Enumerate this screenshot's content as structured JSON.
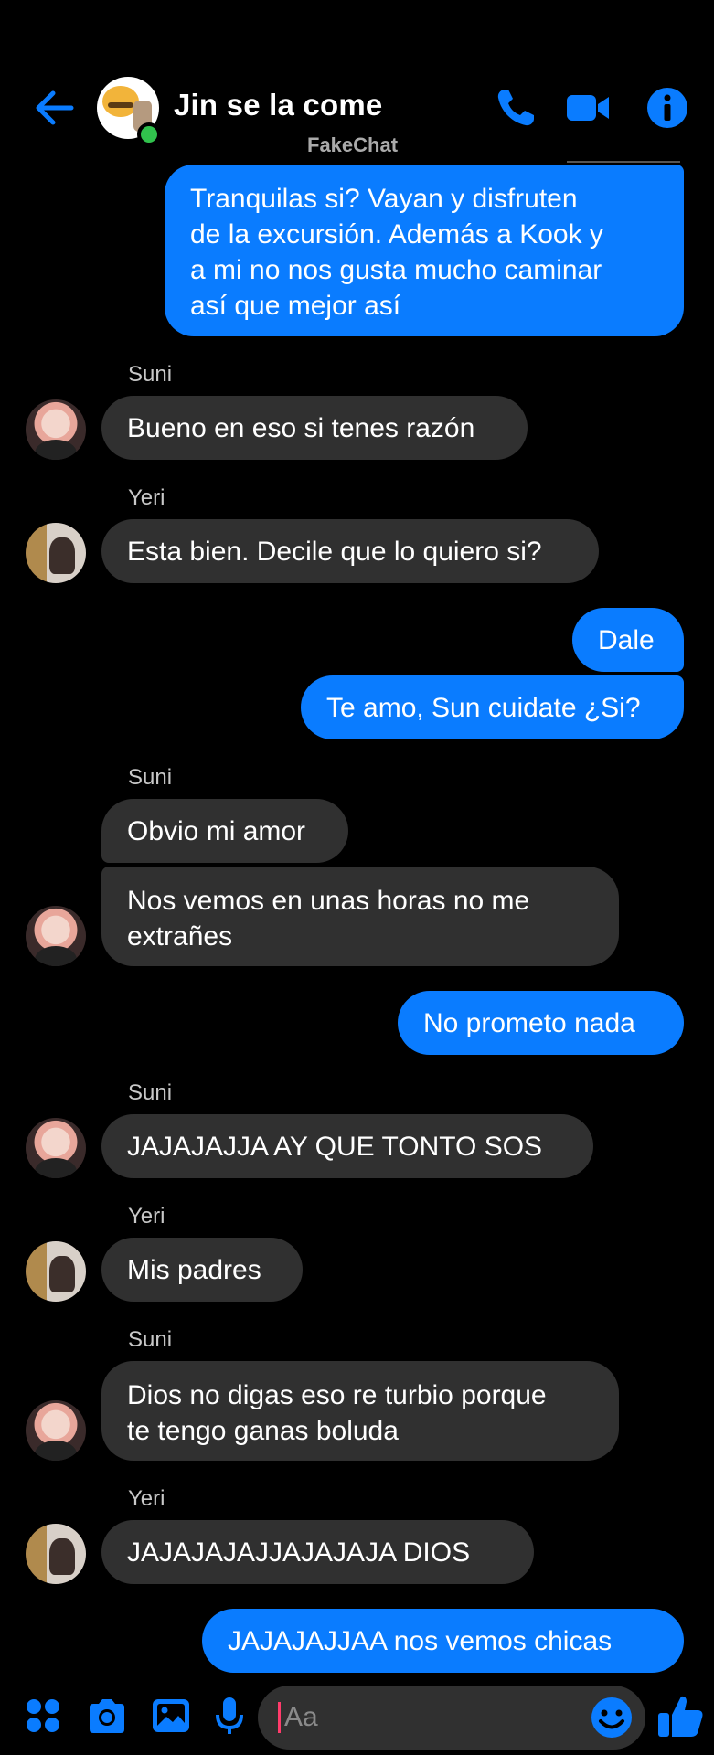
{
  "header": {
    "title": "Jin se la come",
    "watermark": "FakeChat"
  },
  "colors": {
    "accent": "#0a7cff",
    "incoming": "#303030",
    "online": "#31c24d"
  },
  "icons": {
    "back": "arrow-left-icon",
    "call": "phone-icon",
    "video": "video-camera-icon",
    "info": "info-icon",
    "apps": "apps-grid-icon",
    "camera": "camera-icon",
    "gallery": "image-icon",
    "mic": "microphone-icon",
    "emoji": "emoji-icon",
    "like": "thumbs-up-icon"
  },
  "messages": [
    {
      "dir": "out",
      "text": "Tranquilas si? Vayan y disfruten\nde la excursión. Además a Kook y\na mi no nos gusta mucho caminar\nasí que mejor así"
    },
    {
      "sender": "Suni",
      "dir": "in",
      "text": "Bueno en eso si tenes razón"
    },
    {
      "sender": "Yeri",
      "dir": "in",
      "text": "Esta bien. Decile que lo quiero si?"
    },
    {
      "dir": "out",
      "text": "Dale"
    },
    {
      "dir": "out",
      "text": "Te amo, Sun cuidate ¿Si?"
    },
    {
      "sender": "Suni",
      "dir": "in",
      "text": "Obvio mi amor"
    },
    {
      "dir": "in",
      "text": "Nos vemos en unas horas no me\nextrañes"
    },
    {
      "dir": "out",
      "text": "No prometo nada"
    },
    {
      "sender": "Suni",
      "dir": "in",
      "text": "JAJAJAJJA AY QUE TONTO SOS"
    },
    {
      "sender": "Yeri",
      "dir": "in",
      "text": "Mis padres"
    },
    {
      "sender": "Suni",
      "dir": "in",
      "text": "Dios no digas eso re turbio porque\nte tengo ganas boluda"
    },
    {
      "sender": "Yeri",
      "dir": "in",
      "text": "JAJAJAJAJJAJAJAJA DIOS"
    },
    {
      "dir": "out",
      "text": "JAJAJAJJAA nos vemos chicas"
    }
  ],
  "composer": {
    "placeholder": "Aa"
  }
}
